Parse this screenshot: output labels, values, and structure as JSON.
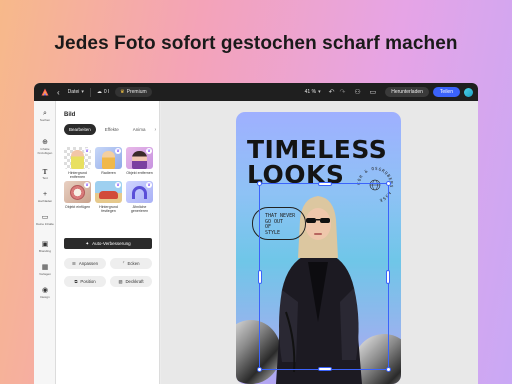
{
  "headline": "Jedes Foto sofort gestochen scharf machen",
  "topbar": {
    "file_label": "Datei",
    "cloud_label": "0 l",
    "premium_label": "Premium",
    "zoom_label": "41 %",
    "download_label": "Herunterladen",
    "share_label": "Teilen"
  },
  "rail": {
    "items": [
      {
        "icon": "search-icon",
        "label": "Suchen"
      },
      {
        "icon": "add-icon",
        "label": "Inhalte hinzufügen"
      },
      {
        "icon": "text-icon",
        "label": "Text"
      },
      {
        "icon": "plus-icon",
        "label": "Hochladen"
      },
      {
        "icon": "folder-icon",
        "label": "Deine Inhalte"
      },
      {
        "icon": "image-icon",
        "label": "Branding"
      },
      {
        "icon": "apps-icon",
        "label": "Vorlagen"
      },
      {
        "icon": "palette-icon",
        "label": "Design"
      }
    ]
  },
  "panel": {
    "title": "Bild",
    "tabs": [
      "Bearbeiten",
      "Effekte",
      "Anima"
    ],
    "tiles": [
      {
        "label": "Hintergrund entfernen"
      },
      {
        "label": "Radieren"
      },
      {
        "label": "Objekt entfernen"
      },
      {
        "label": "Objekt einfügen"
      },
      {
        "label": "Hintergrund festlegen"
      },
      {
        "label": "Ähnliche generieren"
      }
    ],
    "auto_button": "Auto-Verbesserung",
    "chips": [
      "Anpassen",
      "Ecken",
      "Position",
      "Deckkraft"
    ]
  },
  "poster": {
    "title_line1": "TIMELESS",
    "title_line2": "LOOKS",
    "pill_line1": "THAT NEVER",
    "pill_line2": "GO OUT",
    "pill_line3": "OF",
    "pill_line4": "STYLE",
    "ring_text": "COH & OSGRUBERS ASSE"
  },
  "colors": {
    "accent": "#3b63fb",
    "topbar": "#1f1f1f",
    "dark_button": "#2b2b2b"
  }
}
